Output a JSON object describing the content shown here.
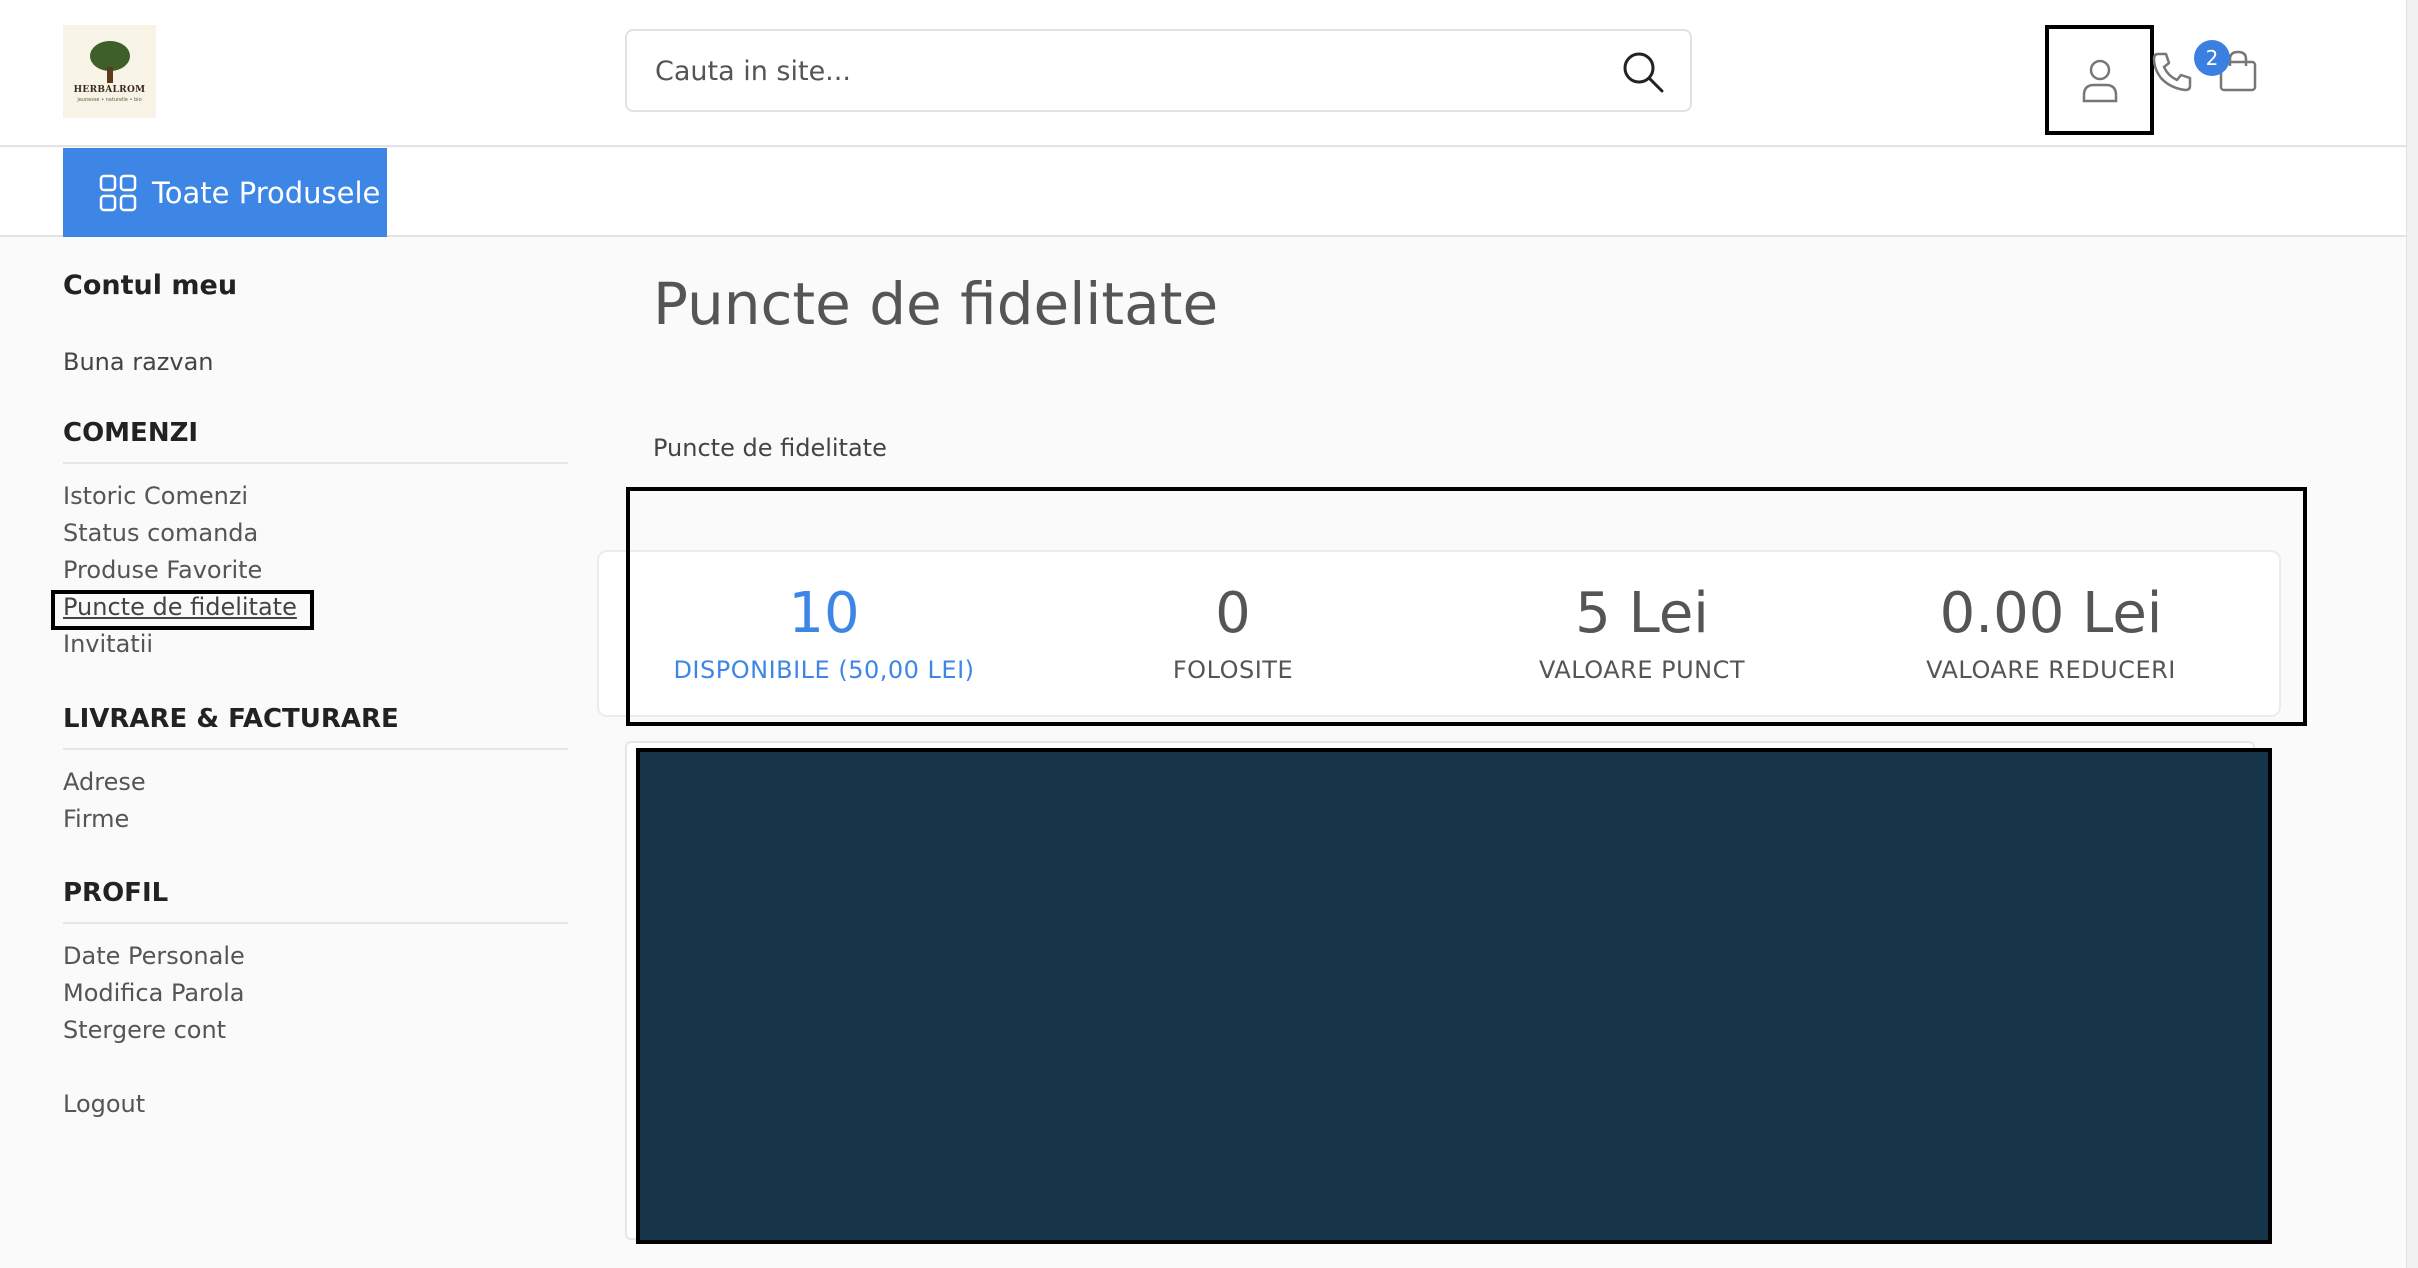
{
  "header": {
    "logo": {
      "name": "HERBALROM",
      "tagline": "jeunesse • naturelle • bio"
    },
    "search": {
      "placeholder": "Cauta in site..."
    },
    "cart_count": "2"
  },
  "navbar": {
    "all_products_label": "Toate Produsele"
  },
  "sidebar": {
    "title": "Contul meu",
    "greeting": "Buna razvan",
    "sections": [
      {
        "title": "COMENZI",
        "links": [
          "Istoric Comenzi",
          "Status comanda",
          "Produse Favorite",
          "Puncte de fidelitate",
          "Invitatii"
        ]
      },
      {
        "title": "LIVRARE & FACTURARE",
        "links": [
          "Adrese",
          "Firme"
        ]
      },
      {
        "title": "PROFIL",
        "links": [
          "Date Personale",
          "Modifica Parola",
          "Stergere cont"
        ]
      }
    ],
    "logout": "Logout"
  },
  "main": {
    "title": "Puncte de fidelitate",
    "subtitle": "Puncte de fidelitate",
    "stats": [
      {
        "value": "10",
        "label": "DISPONIBILE (50,00 LEI)"
      },
      {
        "value": "0",
        "label": "FOLOSITE"
      },
      {
        "value": "5 Lei",
        "label": "VALOARE PUNCT"
      },
      {
        "value": "0.00 Lei",
        "label": "VALOARE REDUCERI"
      }
    ]
  },
  "colors": {
    "accent": "#3e86e6",
    "redacted": "#163548"
  },
  "icons": [
    "logo-tree",
    "search-icon",
    "user-icon",
    "phone-icon",
    "shopping-bag-icon",
    "grid-icon"
  ]
}
